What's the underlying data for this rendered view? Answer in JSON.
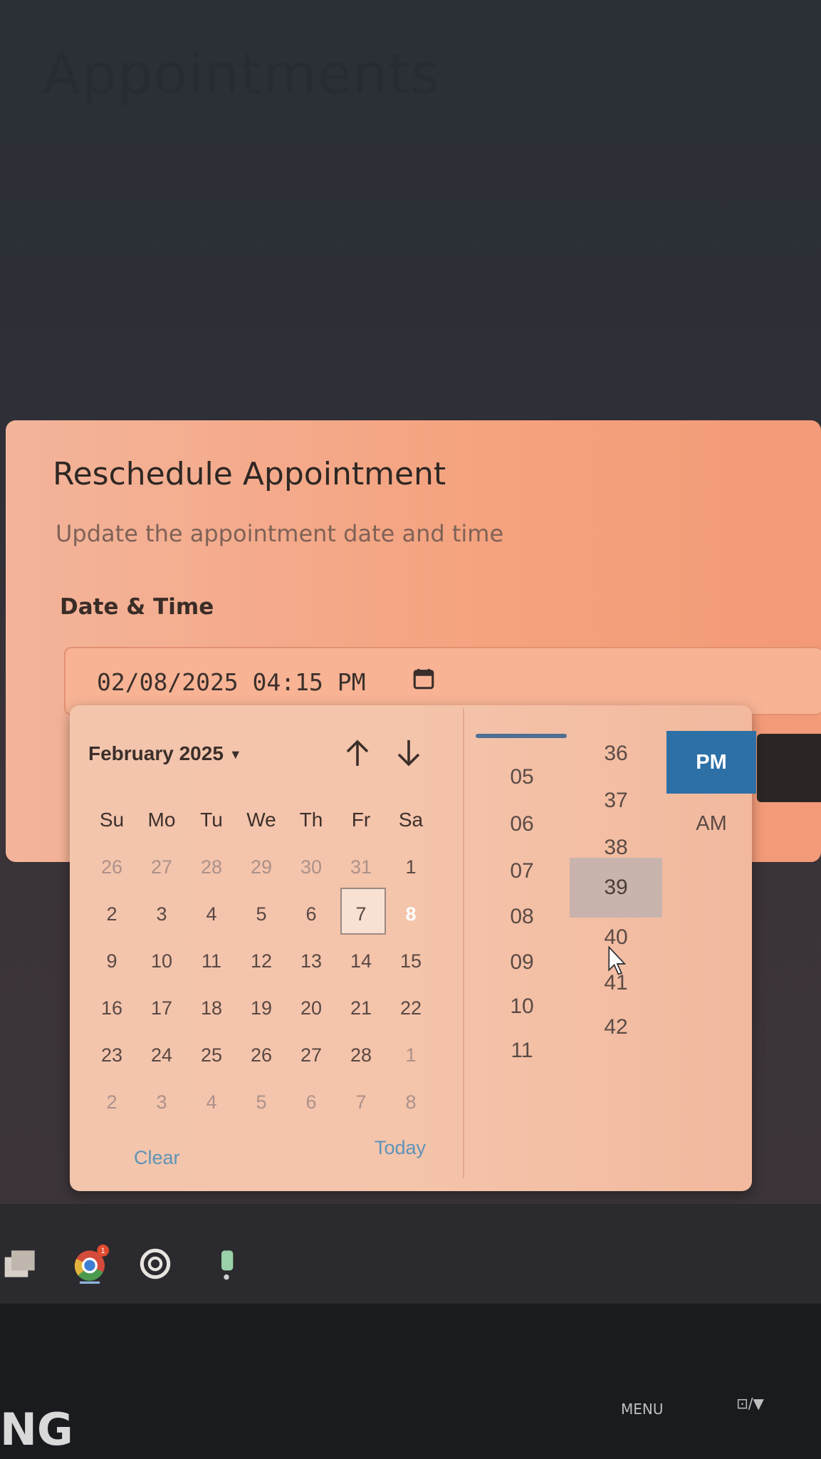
{
  "page": {
    "title": "Appointments"
  },
  "dialog": {
    "title": "Reschedule Appointment",
    "subtitle": "Update the appointment date and time",
    "field_label": "Date & Time",
    "input_value": "02/08/2025 04:15 PM",
    "calendar_icon": "calendar-icon"
  },
  "picker": {
    "month_label": "February 2025",
    "nav_up_icon": "arrow-up-icon",
    "nav_down_icon": "arrow-down-icon",
    "weekdays": [
      "Su",
      "Mo",
      "Tu",
      "We",
      "Th",
      "Fr",
      "Sa"
    ],
    "weeks": [
      [
        {
          "d": "26",
          "o": true
        },
        {
          "d": "27",
          "o": true
        },
        {
          "d": "28",
          "o": true
        },
        {
          "d": "29",
          "o": true
        },
        {
          "d": "30",
          "o": true
        },
        {
          "d": "31",
          "o": true
        },
        {
          "d": "1"
        }
      ],
      [
        {
          "d": "2"
        },
        {
          "d": "3"
        },
        {
          "d": "4"
        },
        {
          "d": "5"
        },
        {
          "d": "6"
        },
        {
          "d": "7",
          "today": true
        },
        {
          "d": "8",
          "selected": true
        }
      ],
      [
        {
          "d": "9"
        },
        {
          "d": "10"
        },
        {
          "d": "11"
        },
        {
          "d": "12"
        },
        {
          "d": "13"
        },
        {
          "d": "14"
        },
        {
          "d": "15"
        }
      ],
      [
        {
          "d": "16"
        },
        {
          "d": "17"
        },
        {
          "d": "18"
        },
        {
          "d": "19"
        },
        {
          "d": "20"
        },
        {
          "d": "21"
        },
        {
          "d": "22"
        }
      ],
      [
        {
          "d": "23"
        },
        {
          "d": "24"
        },
        {
          "d": "25"
        },
        {
          "d": "26"
        },
        {
          "d": "27"
        },
        {
          "d": "28"
        },
        {
          "d": "1",
          "o": true
        }
      ],
      [
        {
          "d": "2",
          "o": true
        },
        {
          "d": "3",
          "o": true
        },
        {
          "d": "4",
          "o": true
        },
        {
          "d": "5",
          "o": true
        },
        {
          "d": "6",
          "o": true
        },
        {
          "d": "7",
          "o": true
        },
        {
          "d": "8",
          "o": true
        }
      ]
    ],
    "clear_label": "Clear",
    "today_label": "Today",
    "hours": [
      "05",
      "06",
      "07",
      "08",
      "09",
      "10",
      "11"
    ],
    "minutes": [
      "36",
      "37",
      "38",
      "39",
      "40",
      "41",
      "42"
    ],
    "hovered_minute": "39",
    "pm_label": "PM",
    "am_label": "AM"
  },
  "taskbar": {
    "icons": [
      "file-explorer-icon",
      "chrome-icon",
      "chatgpt-icon",
      "app-icon"
    ],
    "chrome_badge": "1"
  },
  "monitor": {
    "brand": "NG",
    "menu_label": "MENU",
    "source_label": "⊡/▼"
  }
}
